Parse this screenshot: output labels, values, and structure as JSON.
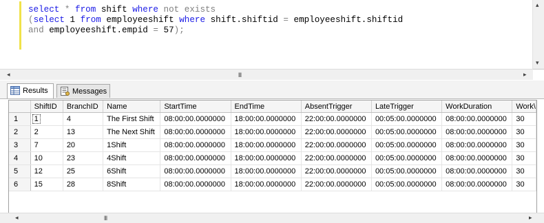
{
  "editor": {
    "line1": {
      "kw1": "select",
      "star": " * ",
      "kw2": "from",
      "t1": " shift ",
      "kw3": "where",
      "gr1": " not exists"
    },
    "line2": {
      "gr1": "(",
      "kw1": "select",
      "t1": " 1 ",
      "kw2": "from",
      "t2": " employeeshift ",
      "kw3": "where",
      "t3": " shift.shiftid ",
      "gr2": "=",
      "t4": " employeeshift.shiftid"
    },
    "line3": {
      "gr1": "and",
      "t1": " employeeshift.empid ",
      "gr2": "=",
      "t2": " 57",
      "gr3": ");"
    }
  },
  "scroll": {
    "left_arrow": "◂",
    "right_arrow": "▸",
    "up_arrow": "▴",
    "down_arrow": "▾",
    "thumb": "III"
  },
  "tabs": [
    {
      "label": "Results",
      "icon": "grid-icon",
      "active": true
    },
    {
      "label": "Messages",
      "icon": "messages-icon",
      "active": false
    }
  ],
  "results": {
    "columns": [
      "ShiftID",
      "BranchID",
      "Name",
      "StartTime",
      "EndTime",
      "AbsentTrigger",
      "LateTrigger",
      "WorkDuration",
      "Work\\"
    ],
    "rows": [
      {
        "num": "1",
        "cells": [
          "1",
          "4",
          "The First Shift",
          "08:00:00.0000000",
          "18:00:00.0000000",
          "22:00:00.0000000",
          "00:05:00.0000000",
          "08:00:00.0000000",
          "30"
        ]
      },
      {
        "num": "2",
        "cells": [
          "2",
          "13",
          "The Next Shift",
          "08:00:00.0000000",
          "18:00:00.0000000",
          "22:00:00.0000000",
          "00:05:00.0000000",
          "08:00:00.0000000",
          "30"
        ]
      },
      {
        "num": "3",
        "cells": [
          "7",
          "20",
          "1Shift",
          "08:00:00.0000000",
          "18:00:00.0000000",
          "22:00:00.0000000",
          "00:05:00.0000000",
          "08:00:00.0000000",
          "30"
        ]
      },
      {
        "num": "4",
        "cells": [
          "10",
          "23",
          "4Shift",
          "08:00:00.0000000",
          "18:00:00.0000000",
          "22:00:00.0000000",
          "00:05:00.0000000",
          "08:00:00.0000000",
          "30"
        ]
      },
      {
        "num": "5",
        "cells": [
          "12",
          "25",
          "6Shift",
          "08:00:00.0000000",
          "18:00:00.0000000",
          "22:00:00.0000000",
          "00:05:00.0000000",
          "08:00:00.0000000",
          "30"
        ]
      },
      {
        "num": "6",
        "cells": [
          "15",
          "28",
          "8Shift",
          "08:00:00.0000000",
          "18:00:00.0000000",
          "22:00:00.0000000",
          "00:05:00.0000000",
          "08:00:00.0000000",
          "30"
        ]
      }
    ]
  },
  "colors": {
    "keyword": "#1a1ae6",
    "operator": "#808080",
    "change_bar": "#f0e24a"
  }
}
